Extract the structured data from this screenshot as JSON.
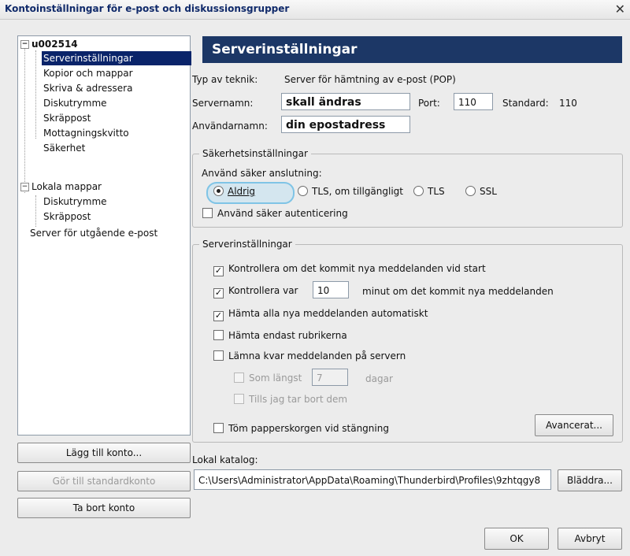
{
  "window": {
    "title": "Kontoinställningar för e-post och diskussionsgrupper",
    "close_glyph": "✕"
  },
  "tree": {
    "account": "u002514",
    "items": [
      "Serverinställningar",
      "Kopior och mappar",
      "Skriva & adressera",
      "Diskutrymme",
      "Skräppost",
      "Mottagningskvitto",
      "Säkerhet"
    ],
    "local": "Lokala mappar",
    "local_items": [
      "Diskutrymme",
      "Skräppost"
    ],
    "outgoing": "Server för utgående e-post"
  },
  "account_buttons": {
    "add": "Lägg till konto...",
    "default": "Gör till standardkonto",
    "remove": "Ta bort konto"
  },
  "panel": {
    "title": "Serverinställningar",
    "type_label": "Typ av teknik:",
    "type_value": "Server för hämtning av e-post (POP)",
    "server_label": "Servernamn:",
    "server_value": "skall ändras",
    "port_label": "Port:",
    "port_value": "110",
    "standard_label": "Standard:",
    "standard_value": "110",
    "user_label": "Användarnamn:",
    "user_value": "din epostadress"
  },
  "security": {
    "legend": "Säkerhetsinställningar",
    "connection_label": "Använd säker anslutning:",
    "options": [
      "Aldrig",
      "TLS, om tillgängligt",
      "TLS",
      "SSL"
    ],
    "selected": "Aldrig",
    "secure_auth": "Använd säker autenticering"
  },
  "server": {
    "legend": "Serverinställningar",
    "check_start": "Kontrollera om det kommit nya meddelanden vid start",
    "check_every_prefix": "Kontrollera var",
    "check_every_value": "10",
    "check_every_suffix": "minut om det kommit nya meddelanden",
    "download_auto": "Hämta alla nya meddelanden automatiskt",
    "headers_only": "Hämta endast rubrikerna",
    "leave_on_server": "Lämna kvar meddelanden på servern",
    "longest_prefix": "Som längst",
    "longest_value": "7",
    "longest_suffix": "dagar",
    "until_deleted": "Tills jag tar bort dem",
    "empty_trash": "Töm papperskorgen vid stängning",
    "advanced": "Avancerat..."
  },
  "local_dir": {
    "label": "Lokal katalog:",
    "path": "C:\\Users\\Administrator\\AppData\\Roaming\\Thunderbird\\Profiles\\9zhtqgy8",
    "browse": "Bläddra..."
  },
  "dialog": {
    "ok": "OK",
    "cancel": "Avbryt"
  }
}
